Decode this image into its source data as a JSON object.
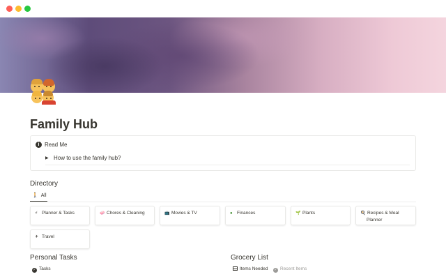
{
  "window": {
    "controls": [
      "close",
      "minimize",
      "zoom"
    ]
  },
  "page": {
    "title": "Family Hub",
    "icon": "family-emoji-icon"
  },
  "callout": {
    "icon": "info-icon",
    "title": "Read Me",
    "toggle_label": "How to use the family hub?"
  },
  "directory": {
    "heading": "Directory",
    "view_tab": "All",
    "view_tab_icon": "person-icon",
    "cards": [
      {
        "label": "Planner & Tasks",
        "icon": "lightning-icon",
        "emoji": "⚡"
      },
      {
        "label": "Chores & Cleaning",
        "icon": "soap-icon",
        "emoji": "🧼"
      },
      {
        "label": "Movies & TV",
        "icon": "tv-icon",
        "emoji": "📺"
      },
      {
        "label": "Finances",
        "icon": "money-icon",
        "emoji": "🟢"
      },
      {
        "label": "Plants",
        "icon": "plant-icon",
        "emoji": "🌱"
      },
      {
        "label": "Recipes & Meal Planner",
        "icon": "recipe-icon",
        "emoji": "🍳"
      },
      {
        "label": "Travel",
        "icon": "airplane-icon",
        "emoji": "✈"
      }
    ]
  },
  "personal_tasks": {
    "heading": "Personal Tasks",
    "view": "Tasks"
  },
  "grocery": {
    "heading": "Grocery List",
    "views": [
      "Items Needed",
      "Recent Items"
    ]
  },
  "colors": {
    "text": "#37352f",
    "muted": "#9b9a97",
    "border": "#e9e9e7"
  }
}
